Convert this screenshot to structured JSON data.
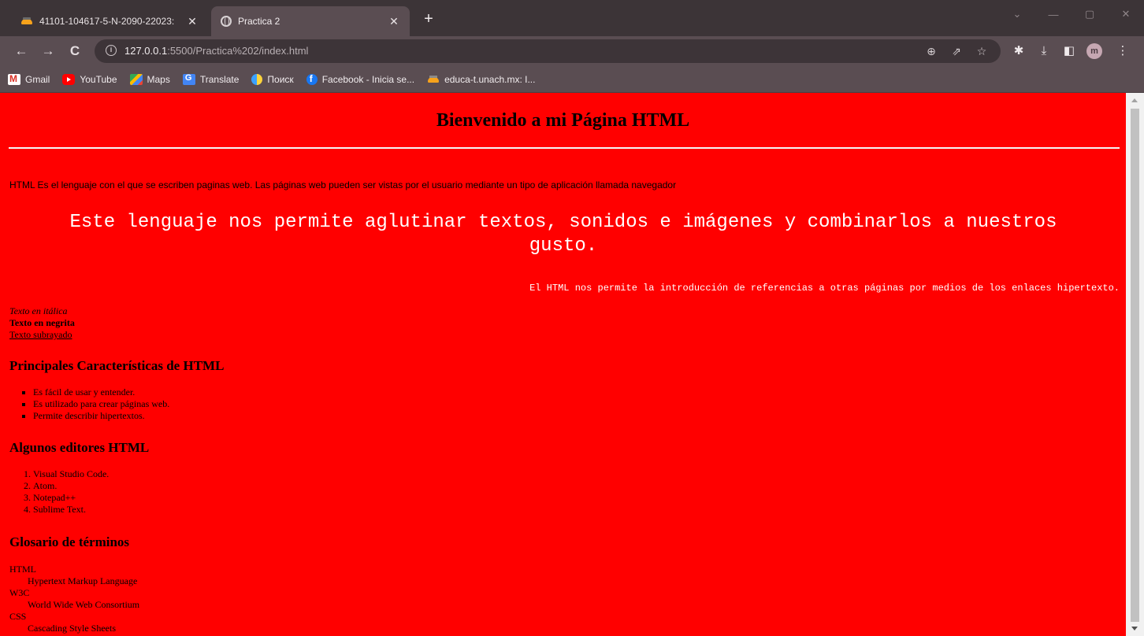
{
  "browser": {
    "tabs": [
      {
        "title": "41101-104617-5-N-2090-22023:",
        "active": false
      },
      {
        "title": "Practica 2",
        "active": true
      }
    ],
    "new_tab": "+",
    "window_controls": {
      "tab_search": "⌄",
      "minimize": "—",
      "restore": "▢",
      "close": "✕"
    },
    "address": {
      "host": "127.0.0.1",
      "rest": ":5500/Practica%202/index.html"
    },
    "profile_initial": "m",
    "bookmarks": [
      {
        "label": "Gmail",
        "icon": "gmail-icon"
      },
      {
        "label": "YouTube",
        "icon": "youtube-icon"
      },
      {
        "label": "Maps",
        "icon": "maps-icon"
      },
      {
        "label": "Translate",
        "icon": "translate-icon"
      },
      {
        "label": "Поиск",
        "icon": "search-engine-icon"
      },
      {
        "label": "Facebook - Inicia se...",
        "icon": "facebook-icon"
      },
      {
        "label": "educa-t.unach.mx: I...",
        "icon": "moodle-icon"
      }
    ]
  },
  "page": {
    "background": "#ff0000",
    "heading": "Bienvenido a mi Página HTML",
    "intro": "HTML Es el lenguaje con el que se escriben paginas web. Las páginas web pueden ser vistas por el usuario mediante un tipo de aplicación llamada navegador",
    "mono_big": "Este lenguaje nos permite aglutinar textos, sonidos e imágenes y combinarlos a nuestros gusto.",
    "mono_small": "El HTML nos permite la introducción de referencias a otras páginas por medios de los enlaces hipertexto.",
    "italic": "Texto en itálica",
    "bold": "Texto en negrita",
    "underline": "Texto subrayado",
    "features_heading": "Principales Características de HTML",
    "features": [
      "Es fácil de usar y entender.",
      "Es utilizado para crear páginas web.",
      "Permite describir hipertextos."
    ],
    "editors_heading": "Algunos editores HTML",
    "editors": [
      "Visual Studio Code.",
      "Atom.",
      "Notepad++",
      "Sublime Text."
    ],
    "glossary_heading": "Glosario de términos",
    "glossary": [
      {
        "term": "HTML",
        "def": "Hypertext Markup Language"
      },
      {
        "term": "W3C",
        "def": "World Wide Web Consortium"
      },
      {
        "term": "CSS",
        "def": "Cascading Style Sheets"
      }
    ]
  }
}
